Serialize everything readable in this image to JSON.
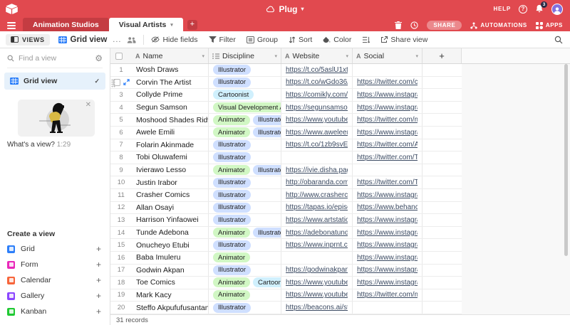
{
  "app": {
    "title": "Plug",
    "help_label": "HELP",
    "notification_count": "3"
  },
  "tabs": {
    "items": [
      {
        "label": "Animation Studios",
        "active": false
      },
      {
        "label": "Visual Artists",
        "active": true
      }
    ],
    "add_label": "+"
  },
  "topbar_actions": {
    "share": "SHARE",
    "automations": "AUTOMATIONS",
    "apps": "APPS"
  },
  "toolbar": {
    "views": "VIEWS",
    "view_name": "Grid view",
    "more": "...",
    "hide_fields": "Hide fields",
    "filter": "Filter",
    "group": "Group",
    "sort": "Sort",
    "color": "Color",
    "share_view": "Share view"
  },
  "sidebar": {
    "search_placeholder": "Find a view",
    "selected_view": "Grid view",
    "video_card": {
      "title": "What's a view?",
      "duration": "1:29"
    },
    "create_section": {
      "title": "Create a view",
      "items": [
        {
          "label": "Grid",
          "color": "#2d7ff9"
        },
        {
          "label": "Form",
          "color": "#e929ba"
        },
        {
          "label": "Calendar",
          "color": "#f7653b"
        },
        {
          "label": "Gallery",
          "color": "#8b46ff"
        },
        {
          "label": "Kanban",
          "color": "#20c933"
        }
      ]
    }
  },
  "grid": {
    "columns": [
      {
        "key": "name",
        "label": "Name",
        "type": "text"
      },
      {
        "key": "discipline",
        "label": "Discipline",
        "type": "multiselect"
      },
      {
        "key": "website",
        "label": "Website",
        "type": "text"
      },
      {
        "key": "social",
        "label": "Social",
        "type": "text"
      }
    ],
    "add_field_label": "+",
    "pill_colors": {
      "blue": "#cfdfff",
      "green": "#d1f7c4",
      "cyan": "#d0f0fd"
    },
    "rows": [
      {
        "num": "1",
        "name": "Wosh Draws",
        "disciplines": [
          {
            "label": "Illustrator",
            "bg": "#cfdfff"
          }
        ],
        "website": "https://t.co/5aslU1xtXl?a...",
        "social": "",
        "selected": false
      },
      {
        "num": "2",
        "name": "Corvin The Artist",
        "disciplines": [
          {
            "label": "Illustrator",
            "bg": "#cfdfff"
          }
        ],
        "website": "https://t.co/wGdo36A6K...",
        "social": "https://twitter.com/corvin...",
        "selected": true
      },
      {
        "num": "3",
        "name": "Collyde Prime",
        "disciplines": [
          {
            "label": "Cartoonist",
            "bg": "#d0f0fd"
          }
        ],
        "website": "https://comikly.com/comi...",
        "social": "https://www.instagram.co...",
        "selected": false
      },
      {
        "num": "4",
        "name": "Segun Samson",
        "disciplines": [
          {
            "label": "Visual Development Art...",
            "bg": "#d1f7c4"
          }
        ],
        "website": "https://segunsamson.arts...",
        "social": "https://www.instagram.co...",
        "selected": false
      },
      {
        "num": "5",
        "name": "Moshood Shades Ridwan",
        "disciplines": [
          {
            "label": "Animator",
            "bg": "#d1f7c4"
          },
          {
            "label": "Illustrator",
            "bg": "#cfdfff"
          }
        ],
        "website": "https://www.youtube.com...",
        "social": "https://twitter.com/mosh...",
        "selected": false
      },
      {
        "num": "6",
        "name": "Awele Emili",
        "disciplines": [
          {
            "label": "Animator",
            "bg": "#d1f7c4"
          },
          {
            "label": "Illustrator",
            "bg": "#cfdfff"
          }
        ],
        "website": "https://www.aweleemili.c...",
        "social": "https://www.instagram.co...",
        "selected": false
      },
      {
        "num": "7",
        "name": "Folarin Akinmade",
        "disciplines": [
          {
            "label": "Illustrator",
            "bg": "#cfdfff"
          }
        ],
        "website": "https://t.co/1zb9svEWMh...",
        "social": "https://twitter.com/A_Kin...",
        "selected": false
      },
      {
        "num": "8",
        "name": "Tobi Oluwafemi",
        "disciplines": [
          {
            "label": "Illustrator",
            "bg": "#cfdfff"
          }
        ],
        "website": "",
        "social": "https://twitter.com/TobiOl...",
        "selected": false
      },
      {
        "num": "9",
        "name": "Ivierawo Lesso",
        "disciplines": [
          {
            "label": "Animator",
            "bg": "#d1f7c4"
          },
          {
            "label": "Illustrator",
            "bg": "#cfdfff"
          }
        ],
        "website": "https://ivie.disha.page/",
        "social": "",
        "selected": false
      },
      {
        "num": "10",
        "name": "Justin Irabor",
        "disciplines": [
          {
            "label": "Illustrator",
            "bg": "#cfdfff"
          }
        ],
        "website": "http://obaranda.com/com...",
        "social": "https://twitter.com/TheVu...",
        "selected": false
      },
      {
        "num": "11",
        "name": "Crasher Comics",
        "disciplines": [
          {
            "label": "Illustrator",
            "bg": "#cfdfff"
          }
        ],
        "website": "http://www.crashercomic...",
        "social": "https://www.instagram.co...",
        "selected": false
      },
      {
        "num": "12",
        "name": "Allan Osayi",
        "disciplines": [
          {
            "label": "Illustrator",
            "bg": "#cfdfff"
          }
        ],
        "website": "https://tapas.io/episode/1...",
        "social": "https://www.behance.net/...",
        "selected": false
      },
      {
        "num": "13",
        "name": "Harrison Yinfaowei",
        "disciplines": [
          {
            "label": "Illustrator",
            "bg": "#cfdfff"
          }
        ],
        "website": "https://www.artstation.co...",
        "social": "https://www.instagram.co...",
        "selected": false
      },
      {
        "num": "14",
        "name": "Tunde Adebona",
        "disciplines": [
          {
            "label": "Animator",
            "bg": "#d1f7c4"
          },
          {
            "label": "Illustrator",
            "bg": "#cfdfff"
          }
        ],
        "website": "https://adebonatunde.wix...",
        "social": "https://www.instagram.co...",
        "selected": false
      },
      {
        "num": "15",
        "name": "Onucheyo Etubi",
        "disciplines": [
          {
            "label": "Illustrator",
            "bg": "#cfdfff"
          }
        ],
        "website": "https://www.inprnt.com/g...",
        "social": "https://www.instagram.co...",
        "selected": false
      },
      {
        "num": "16",
        "name": "Baba Imuleru",
        "disciplines": [
          {
            "label": "Animator",
            "bg": "#d1f7c4"
          }
        ],
        "website": "",
        "social": "https://www.instagram.co...",
        "selected": false
      },
      {
        "num": "17",
        "name": "Godwin Akpan",
        "disciplines": [
          {
            "label": "Illustrator",
            "bg": "#cfdfff"
          }
        ],
        "website": "https://godwinakpan.artst...",
        "social": "https://www.instagram.co...",
        "selected": false
      },
      {
        "num": "18",
        "name": "Toe Comics",
        "disciplines": [
          {
            "label": "Animator",
            "bg": "#d1f7c4"
          },
          {
            "label": "Cartoonist",
            "bg": "#d0f0fd"
          }
        ],
        "website": "https://www.youtube.com...",
        "social": "https://www.instagram.co...",
        "selected": false
      },
      {
        "num": "19",
        "name": "Mark Kacy",
        "disciplines": [
          {
            "label": "Animator",
            "bg": "#d1f7c4"
          }
        ],
        "website": "https://www.youtube.com...",
        "social": "https://twitter.com/mark_...",
        "selected": false
      },
      {
        "num": "20",
        "name": "Steffo Akpufufusantana",
        "disciplines": [
          {
            "label": "Illustrator",
            "bg": "#cfdfff"
          }
        ],
        "website": "https://beacons.ai/steffot...",
        "social": "",
        "selected": false
      }
    ],
    "footer": "31 records"
  }
}
